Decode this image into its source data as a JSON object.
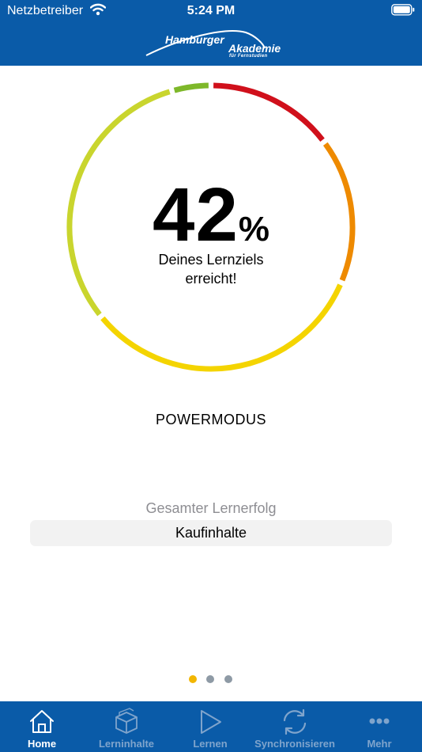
{
  "status_bar": {
    "carrier": "Netzbetreiber",
    "time": "5:24 PM"
  },
  "logo": {
    "line1": "Hamburger",
    "line2": "Akademie",
    "line3": "für Fernstudien"
  },
  "progress": {
    "percent_value": "42",
    "percent_sign": "%",
    "caption_line1": "Deines Lernziels",
    "caption_line2": "erreicht!"
  },
  "mode_label": "POWERMODUS",
  "overall_label": "Gesamter Lernerfolg",
  "shop_button_label": "Kaufinhalte",
  "pager": {
    "pages": 3,
    "active_index": 0,
    "active_color": "#f2b600",
    "inactive_color": "#8e9aa5"
  },
  "colors": {
    "header_bg": "#0a5ba8",
    "tab_active": "#ffffff",
    "tab_inactive": "#7fa4cc",
    "gauge_segments": [
      "#d0101b",
      "#ee8a00",
      "#f4d400",
      "#c9d52e",
      "#7eb82a"
    ]
  },
  "tabs": [
    {
      "label": "Home",
      "icon": "home-icon",
      "active": true
    },
    {
      "label": "Lerninhalte",
      "icon": "box-icon",
      "active": false
    },
    {
      "label": "Lernen",
      "icon": "play-icon",
      "active": false
    },
    {
      "label": "Synchronisieren",
      "icon": "sync-icon",
      "active": false
    },
    {
      "label": "Mehr",
      "icon": "more-icon",
      "active": false
    }
  ]
}
